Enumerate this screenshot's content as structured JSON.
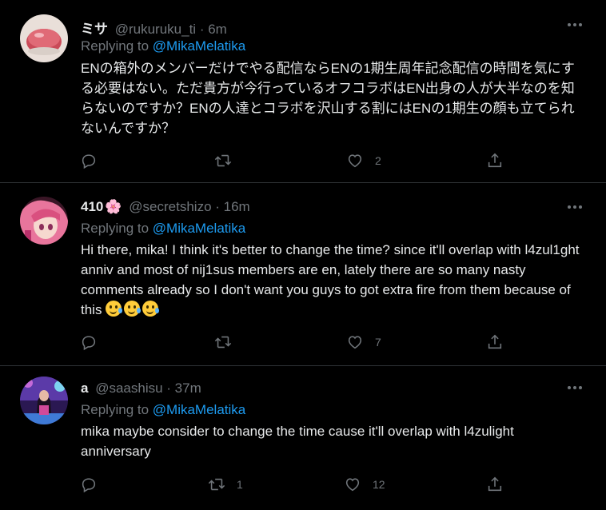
{
  "tweets": [
    {
      "name": "ミサ",
      "handle": "@rukuruku_ti",
      "time": "6m",
      "replying_prefix": "Replying to ",
      "mention": "@MikaMelatika",
      "text": "ENの箱外のメンバーだけでやる配信ならENの1期生周年記念配信の時間を気にする必要はない。ただ貴方が今行っているオフコラボはEN出身の人が大半なのを知らないのですか？ENの人達とコラボを沢山する割にはENの1期生の顔も立てられないんですか？",
      "retweets": "",
      "likes": "2"
    },
    {
      "name": "410",
      "name_emoji": "🌸",
      "handle": "@secretshizo",
      "time": "16m",
      "replying_prefix": "Replying to ",
      "mention": "@MikaMelatika",
      "text": "Hi there, mika! I think it's better to change the time? since it'll overlap with l4zul1ght anniv and most of nij1sus members are en, lately there are so many nasty comments already so I don't want you guys to got extra fire from them because of this",
      "retweets": "",
      "likes": "7"
    },
    {
      "name": "a",
      "handle": "@saashisu",
      "time": "37m",
      "replying_prefix": "Replying to ",
      "mention": "@MikaMelatika",
      "text": "mika maybe consider to change the time cause it'll overlap with l4zulight anniversary",
      "retweets": "1",
      "likes": "12"
    }
  ],
  "separator": " · ",
  "icons": [
    "reply-icon",
    "retweet-icon",
    "like-icon",
    "share-icon",
    "more-icon"
  ],
  "colors": {
    "background": "#000000",
    "text": "#e7e9ea",
    "muted": "#71767b",
    "link": "#1d9bf0",
    "divider": "#2f3336"
  }
}
